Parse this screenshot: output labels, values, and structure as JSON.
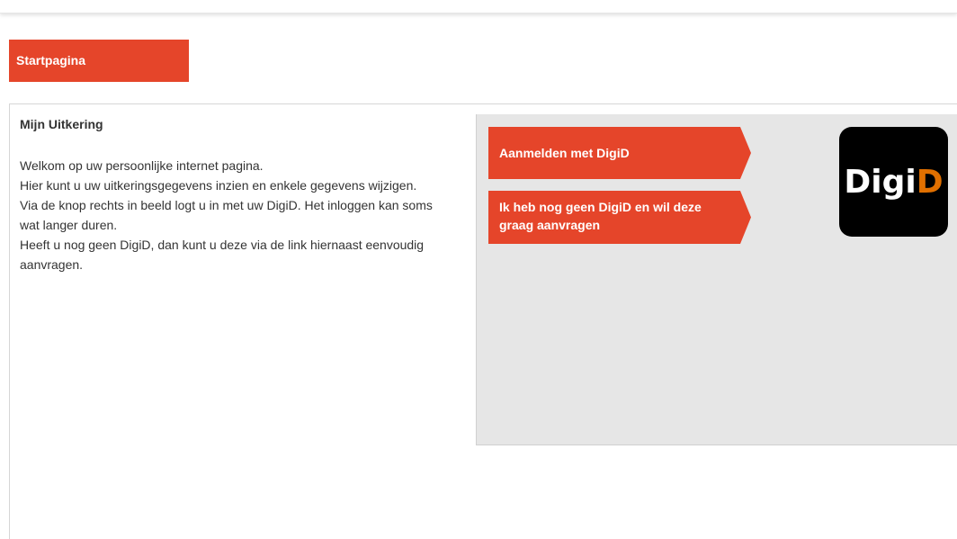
{
  "nav": {
    "home_label": "Startpagina"
  },
  "main": {
    "title": "Mijn Uitkering",
    "paragraphs": [
      "Welkom op uw persoonlijke internet pagina.",
      "Hier kunt u uw uitkeringsgegevens inzien en enkele gegevens wijzigen.",
      "Via de knop rechts in beeld logt u in met uw DigiD. Het inloggen kan soms wat langer duren.",
      "Heeft u nog geen DigiD, dan kunt u deze via de link hiernaast eenvoudig aanvragen."
    ]
  },
  "login": {
    "login_button": "Aanmelden met DigiD",
    "request_button": "Ik heb nog geen DigiD en wil deze graag aanvragen"
  },
  "logo": {
    "part1": "Digi",
    "part2": "D"
  },
  "colors": {
    "accent": "#e5452a",
    "panel_bg": "#e6e6e6",
    "logo_bg": "#000000",
    "logo_orange": "#e17000"
  }
}
